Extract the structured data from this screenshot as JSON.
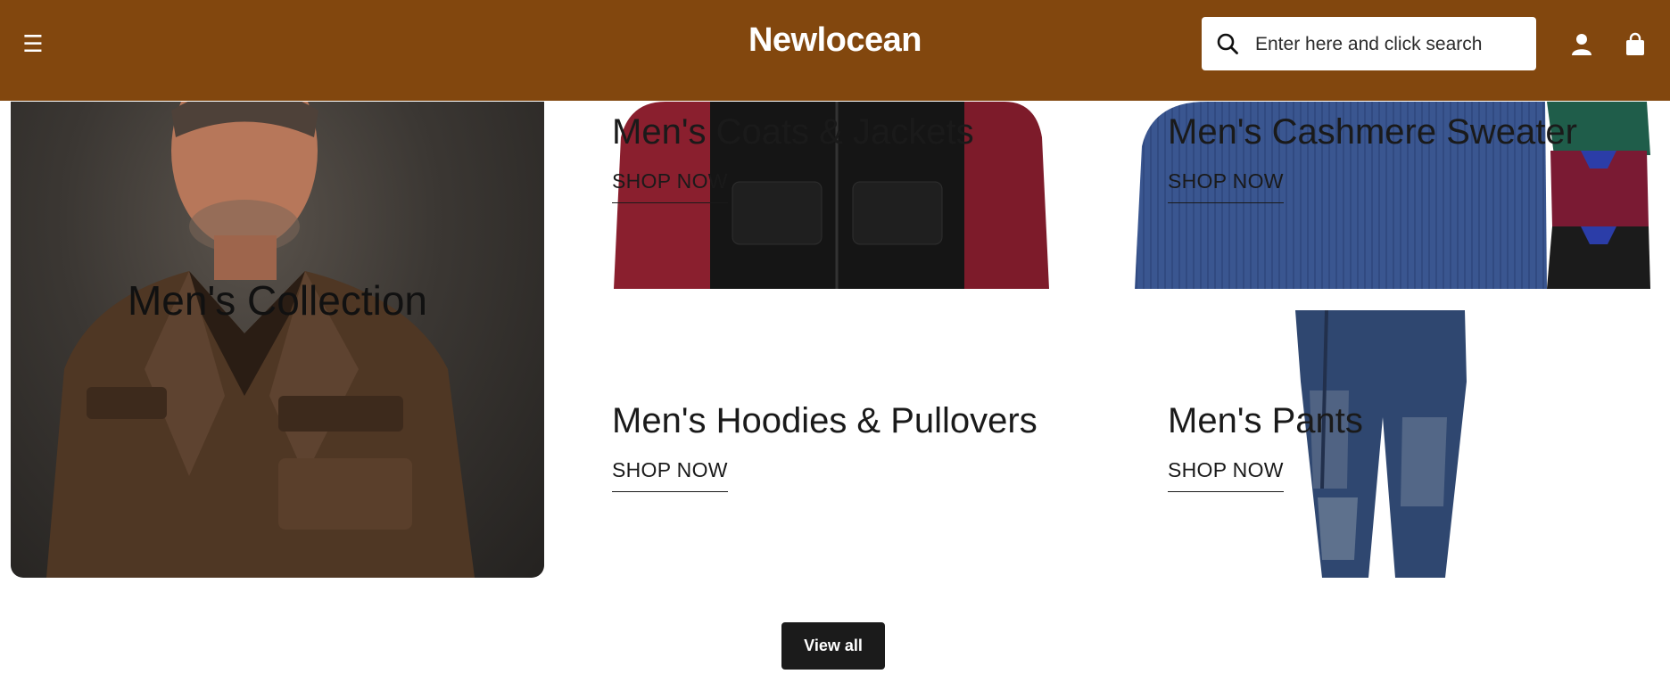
{
  "header": {
    "brand": "Newlocean",
    "menu_icon": "hamburger-icon",
    "search": {
      "placeholder": "Enter here and click search",
      "value": "",
      "icon": "search-icon"
    },
    "account_icon": "user-icon",
    "cart_icon": "shopping-bag-icon"
  },
  "collections": {
    "featured": {
      "title": "Men's Collection"
    },
    "tiles": [
      {
        "title": "Men's Coats & Jackets",
        "link": "SHOP NOW"
      },
      {
        "title": "Men's Cashmere Sweater",
        "link": "SHOP NOW"
      },
      {
        "title": "Men's Hoodies & Pullovers",
        "link": "SHOP NOW"
      },
      {
        "title": "Men's Pants",
        "link": "SHOP NOW"
      }
    ]
  },
  "view_all": {
    "label": "View all"
  },
  "colors": {
    "header_bg": "#82470e",
    "button_bg": "#1b1b1b",
    "text": "#1a1a1a"
  }
}
